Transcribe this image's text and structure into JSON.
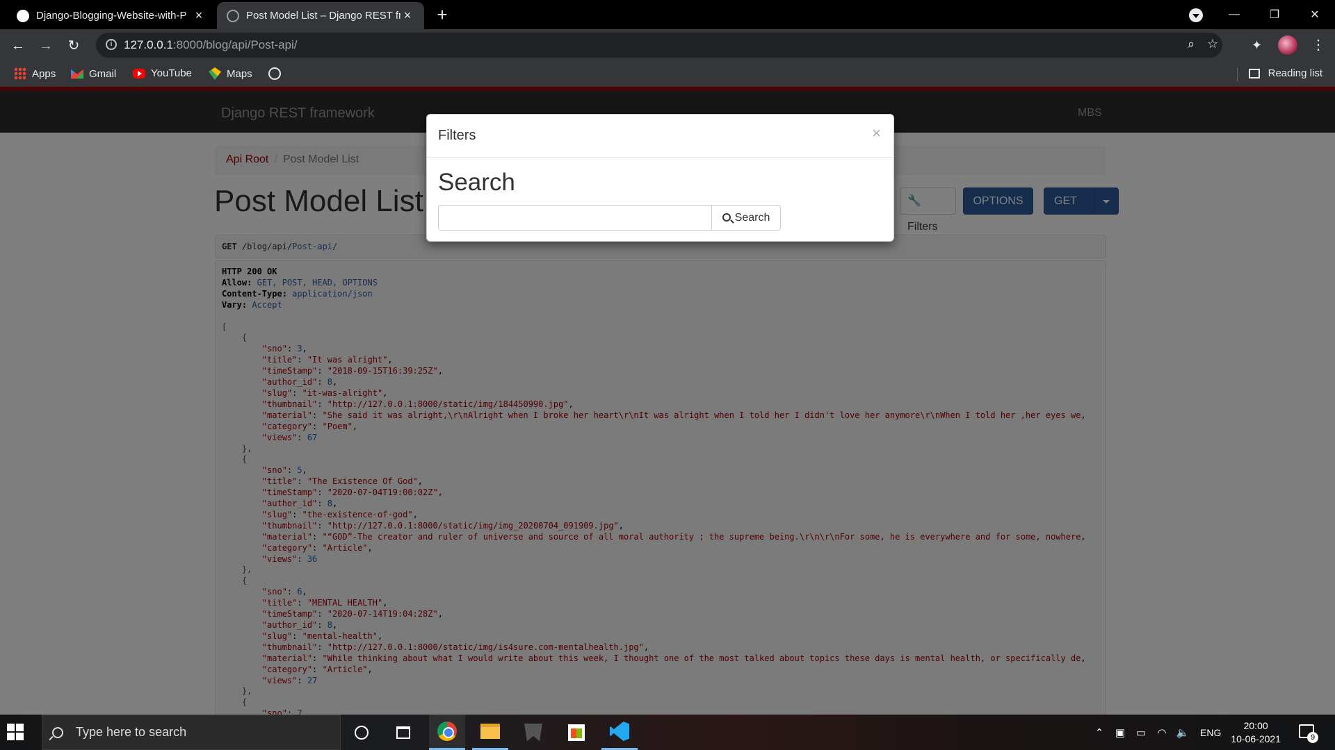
{
  "browser": {
    "tabs": [
      {
        "title": "Django-Blogging-Website-with-P",
        "favicon": "github-icon",
        "active": false
      },
      {
        "title": "Post Model List – Django REST fr",
        "favicon": "globe-icon",
        "active": true
      }
    ],
    "new_tab": "+",
    "url_host": "127.0.0.1",
    "url_rest": ":8000/blog/api/Post-api/",
    "bookmarks": [
      "Apps",
      "Gmail",
      "YouTube",
      "Maps"
    ],
    "reading_list": "Reading list"
  },
  "page": {
    "brand": "Django REST framework",
    "user": "MBS",
    "breadcrumb": {
      "root": "Api Root",
      "sep": "/",
      "current": "Post Model List"
    },
    "title": "Post Model List",
    "buttons": {
      "filters": "Filters",
      "options": "OPTIONS",
      "get": "GET"
    },
    "request": {
      "method": "GET",
      "path_prefix": "/blog/api/",
      "path_rest": "Post-api/"
    },
    "response": {
      "status": "HTTP 200 OK",
      "allow_key": "Allow:",
      "allow_val": "GET, POST, HEAD, OPTIONS",
      "ctype_key": "Content-Type:",
      "ctype_val": "application/json",
      "vary_key": "Vary:",
      "vary_val": "Accept",
      "records": [
        {
          "sno": "3",
          "title": "\"It was alright\"",
          "timeStamp": "\"2018-09-15T16:39:25Z\"",
          "author_id": "8",
          "slug": "\"it-was-alright\"",
          "thumbnail": "\"http://127.0.0.1:8000/static/img/184450990.jpg\"",
          "material": "\"She said it was alright,\\r\\nAlright when I broke her heart\\r\\nIt was alright when I told her I didn't love her anymore\\r\\nWhen I told her ,her eyes we",
          "category": "\"Poem\"",
          "views": "67"
        },
        {
          "sno": "5",
          "title": "\"The Existence Of God\"",
          "timeStamp": "\"2020-07-04T19:00:02Z\"",
          "author_id": "8",
          "slug": "\"the-existence-of-god\"",
          "thumbnail": "\"http://127.0.0.1:8000/static/img/img_20200704_091909.jpg\"",
          "material": "\"“GOD”-The creator and ruler of universe and source of all moral authority ; the supreme being.\\r\\n\\r\\nFor some, he is everywhere and for some, nowhere",
          "category": "\"Article\"",
          "views": "36"
        },
        {
          "sno": "6",
          "title": "\"MENTAL HEALTH\"",
          "timeStamp": "\"2020-07-14T19:04:28Z\"",
          "author_id": "8",
          "slug": "\"mental-health\"",
          "thumbnail": "\"http://127.0.0.1:8000/static/img/is4sure.com-mentalhealth.jpg\"",
          "material": "\"While thinking about what I would write about this week, I thought one of the most talked about topics these days is mental health, or specifically de",
          "category": "\"Article\"",
          "views": "27"
        }
      ],
      "next_sno_partial": "7"
    }
  },
  "modal": {
    "title": "Filters",
    "close": "×",
    "heading": "Search",
    "input_value": "",
    "button": "Search"
  },
  "taskbar": {
    "search_placeholder": "Type here to search",
    "lang": "ENG",
    "time": "20:00",
    "date": "10-06-2021",
    "notif_count": "9"
  }
}
